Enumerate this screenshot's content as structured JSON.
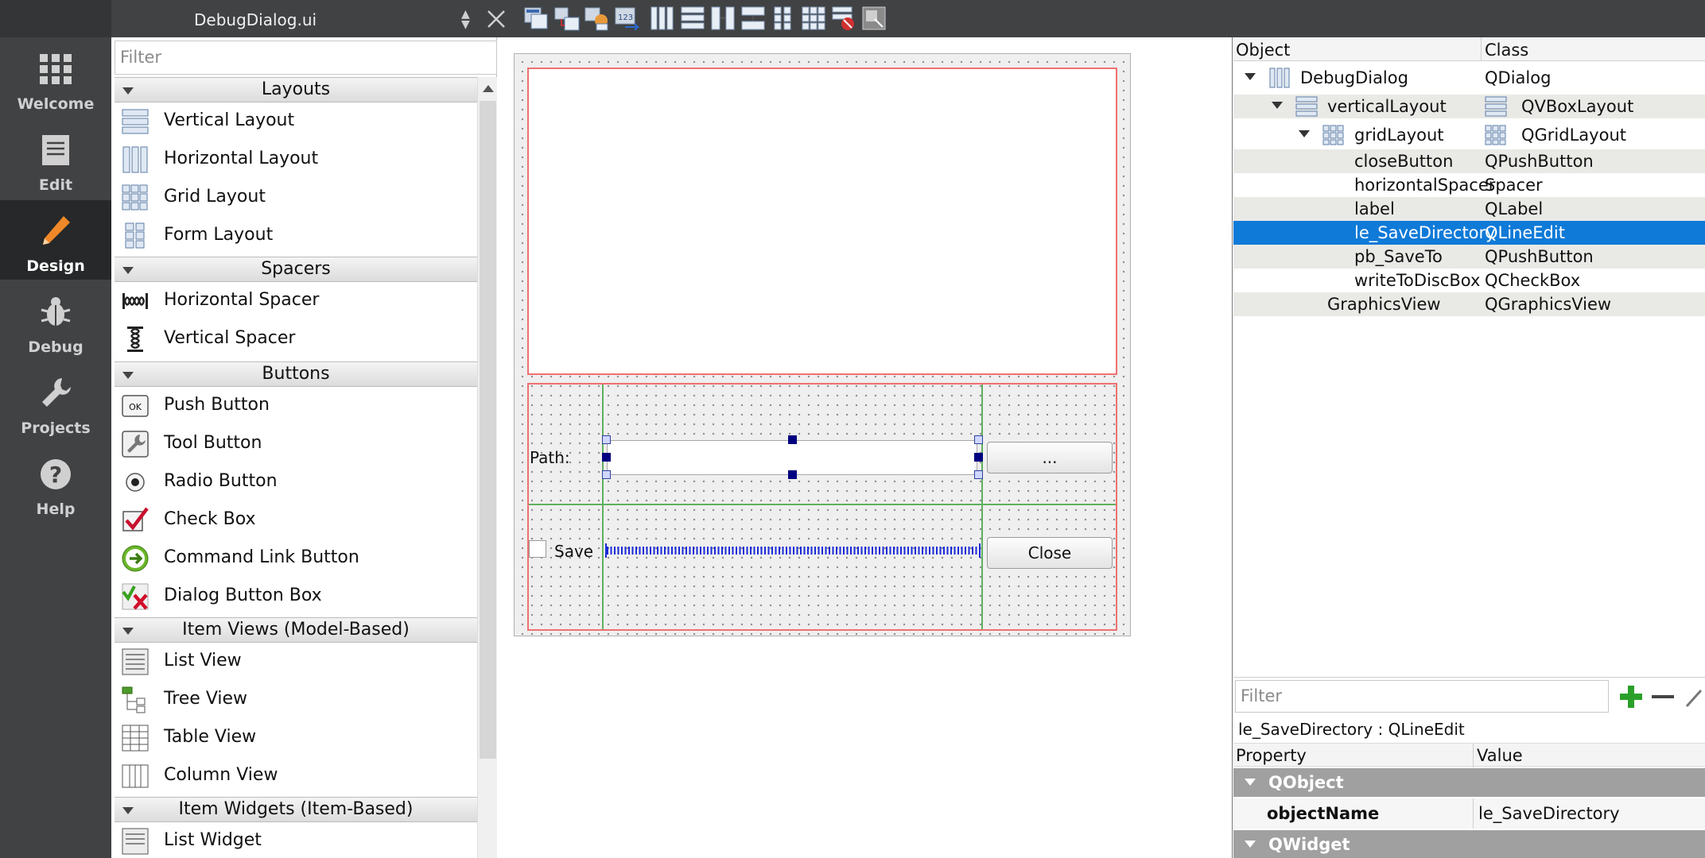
{
  "mode_bar": {
    "items": [
      {
        "label": "Welcome",
        "icon": "grid-icon"
      },
      {
        "label": "Edit",
        "icon": "document-icon"
      },
      {
        "label": "Design",
        "icon": "pencil-icon",
        "active": true
      },
      {
        "label": "Debug",
        "icon": "bug-icon"
      },
      {
        "label": "Projects",
        "icon": "wrench-icon"
      },
      {
        "label": "Help",
        "icon": "question-icon"
      }
    ]
  },
  "toolbar": {
    "file_name": "DebugDialog.ui",
    "tools": [
      "edit-widgets-icon",
      "edit-signals-slots-icon",
      "edit-buddies-icon",
      "edit-tab-order-icon",
      "layout-horizontal-icon",
      "layout-vertical-icon",
      "layout-horizontal-splitter-icon",
      "layout-vertical-splitter-icon",
      "layout-form-icon",
      "layout-grid-icon",
      "break-layout-icon",
      "adjust-size-icon"
    ]
  },
  "widget_box": {
    "filter_placeholder": "Filter",
    "categories": [
      {
        "label": "Layouts",
        "items": [
          "Vertical Layout",
          "Horizontal Layout",
          "Grid Layout",
          "Form Layout"
        ]
      },
      {
        "label": "Spacers",
        "items": [
          "Horizontal Spacer",
          "Vertical Spacer"
        ]
      },
      {
        "label": "Buttons",
        "items": [
          "Push Button",
          "Tool Button",
          "Radio Button",
          "Check Box",
          "Command Link Button",
          "Dialog Button Box"
        ]
      },
      {
        "label": "Item Views (Model-Based)",
        "items": [
          "List View",
          "Tree View",
          "Table View",
          "Column View"
        ]
      },
      {
        "label": "Item Widgets (Item-Based)",
        "items": [
          "List Widget"
        ]
      }
    ]
  },
  "form": {
    "path_label": "Path:",
    "browse_button": "...",
    "save_label": "Save",
    "close_button": "Close"
  },
  "object_inspector": {
    "headers": [
      "Object",
      "Class"
    ],
    "rows": [
      {
        "name": "DebugDialog",
        "class": "QDialog"
      },
      {
        "name": "verticalLayout",
        "class": "QVBoxLayout"
      },
      {
        "name": "gridLayout",
        "class": "QGridLayout"
      },
      {
        "name": "closeButton",
        "class": "QPushButton"
      },
      {
        "name": "horizontalSpacer",
        "class": "Spacer"
      },
      {
        "name": "label",
        "class": "QLabel"
      },
      {
        "name": "le_SaveDirectory",
        "class": "QLineEdit",
        "selected": true
      },
      {
        "name": "pb_SaveTo",
        "class": "QPushButton"
      },
      {
        "name": "writeToDiscBox",
        "class": "QCheckBox"
      },
      {
        "name": "GraphicsView",
        "class": "QGraphicsView"
      }
    ]
  },
  "property_editor": {
    "filter_placeholder": "Filter",
    "object_line": "le_SaveDirectory : QLineEdit",
    "headers": [
      "Property",
      "Value"
    ],
    "groups": [
      "QObject",
      "QWidget"
    ],
    "object_name_property": "objectName",
    "object_name_value": "le_SaveDirectory"
  },
  "colors": {
    "selection": "#0f7ad8",
    "layout_red": "#f07070",
    "grid_green": "#5fb05f",
    "sidebar": "#404244"
  }
}
